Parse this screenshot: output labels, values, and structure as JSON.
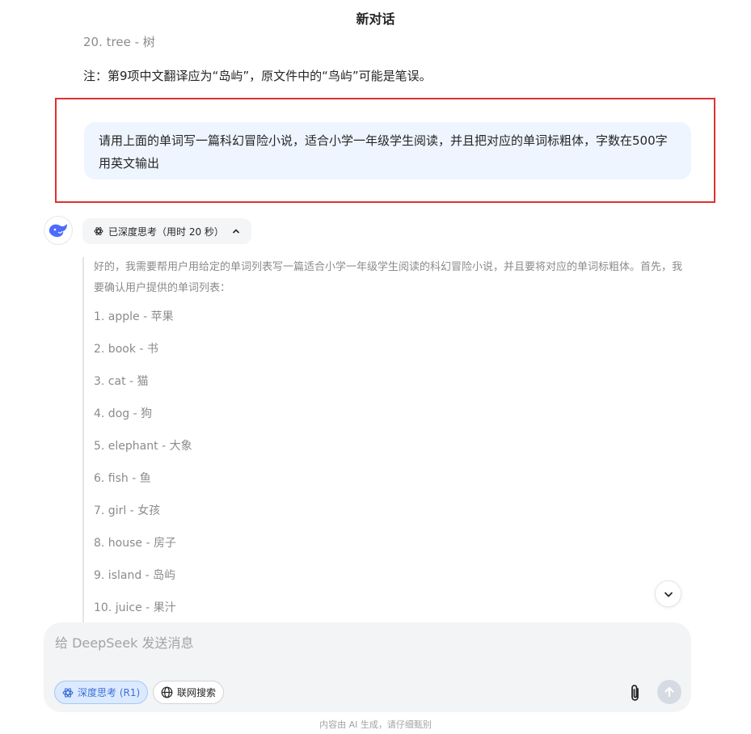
{
  "header": {
    "title": "新对话"
  },
  "previous_answer": {
    "last_list_item": "20. tree - 树",
    "note": "注：第9项中文翻译应为“岛屿”，原文件中的“鸟屿”可能是笔误。"
  },
  "user_message": {
    "text": "请用上面的单词写一篇科幻冒险小说，适合小学一年级学生阅读，并且把对应的单词标粗体，字数在500字用英文输出"
  },
  "assistant": {
    "avatar_icon": "deepseek-whale-logo",
    "thinking_toggle": {
      "label": "已深度思考（用时 20 秒）",
      "icon": "atom-icon",
      "expanded": true
    },
    "thinking": {
      "intro": "好的，我需要帮用户用给定的单词列表写一篇适合小学一年级学生阅读的科幻冒险小说，并且要将对应的单词标粗体。首先，我要确认用户提供的单词列表：",
      "items": [
        "1. apple - 苹果",
        "2. book - 书",
        "3. cat - 猫",
        "4. dog - 狗",
        "5. elephant - 大象",
        "6. fish - 鱼",
        "7. girl - 女孩",
        "8. house - 房子",
        "9. island - 岛屿",
        "10. juice - 果汁"
      ]
    }
  },
  "composer": {
    "placeholder": "给 DeepSeek 发送消息",
    "value": "",
    "deep_think_label": "深度思考 (R1)",
    "deep_think_active": true,
    "web_search_label": "联网搜索",
    "web_search_active": false
  },
  "footer": {
    "disclaimer": "内容由 AI 生成，请仔细甄别"
  },
  "colors": {
    "accent": "#4d6bfe",
    "highlight_border": "#e03131",
    "user_bubble": "#eef5ff",
    "deep_think_pill": "#dbeafe"
  }
}
